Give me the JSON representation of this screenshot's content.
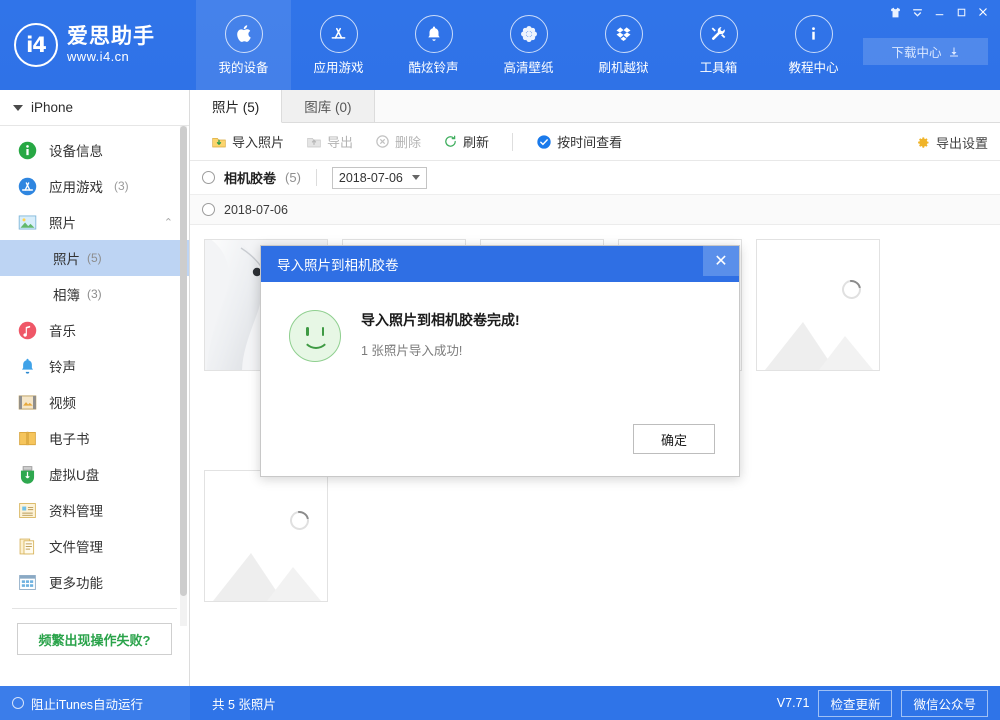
{
  "app": {
    "brand_cn": "爱思助手",
    "brand_url": "www.i4.cn",
    "logo_text": "i4",
    "version": "V7.71"
  },
  "topnav": {
    "items": [
      {
        "label": "我的设备",
        "icon": "apple-icon",
        "active": true
      },
      {
        "label": "应用游戏",
        "icon": "appstore-icon",
        "active": false
      },
      {
        "label": "酷炫铃声",
        "icon": "bell-icon",
        "active": false
      },
      {
        "label": "高清壁纸",
        "icon": "flower-icon",
        "active": false
      },
      {
        "label": "刷机越狱",
        "icon": "box-icon",
        "active": false
      },
      {
        "label": "工具箱",
        "icon": "tools-icon",
        "active": false
      },
      {
        "label": "教程中心",
        "icon": "info-icon",
        "active": false
      }
    ],
    "download_center": "下载中心",
    "window_buttons": [
      "skin-icon",
      "chevron-down-icon",
      "minimize-icon",
      "maximize-icon",
      "close-icon"
    ]
  },
  "sidebar": {
    "device_name": "iPhone",
    "items": [
      {
        "label": "设备信息",
        "count": "",
        "icon": "info-circle-icon"
      },
      {
        "label": "应用游戏",
        "count": "(3)",
        "icon": "appstore-icon"
      },
      {
        "label": "照片",
        "count": "",
        "icon": "photo-icon",
        "expanded": true
      }
    ],
    "photo_subitems": [
      {
        "label": "照片",
        "count": "(5)",
        "selected": true
      },
      {
        "label": "相簿",
        "count": "(3)",
        "selected": false
      }
    ],
    "items_after": [
      {
        "label": "音乐",
        "count": "",
        "icon": "music-icon"
      },
      {
        "label": "铃声",
        "count": "",
        "icon": "ringtone-icon"
      },
      {
        "label": "视频",
        "count": "",
        "icon": "video-icon"
      },
      {
        "label": "电子书",
        "count": "",
        "icon": "book-icon"
      },
      {
        "label": "虚拟U盘",
        "count": "",
        "icon": "usb-icon"
      },
      {
        "label": "资料管理",
        "count": "",
        "icon": "data-icon"
      },
      {
        "label": "文件管理",
        "count": "",
        "icon": "file-icon"
      },
      {
        "label": "更多功能",
        "count": "",
        "icon": "grid-icon"
      }
    ],
    "help_button": "频繁出现操作失败?"
  },
  "main": {
    "tabs": [
      {
        "label": "照片 (5)",
        "active": true
      },
      {
        "label": "图库 (0)",
        "active": false
      }
    ],
    "toolbar": {
      "import": "导入照片",
      "export": "导出",
      "delete": "删除",
      "refresh": "刷新",
      "view_by_time": "按时间查看",
      "export_settings": "导出设置"
    },
    "filter": {
      "album_label": "相机胶卷",
      "album_count": "(5)",
      "date_value": "2018-07-06"
    },
    "date_group": "2018-07-06",
    "thumbnails": [
      {
        "name": "photo-earphones",
        "kind": "photo"
      },
      {
        "name": "photo-placeholder-2",
        "kind": "placeholder"
      },
      {
        "name": "photo-placeholder-3",
        "kind": "placeholder"
      },
      {
        "name": "photo-placeholder-4",
        "kind": "placeholder"
      },
      {
        "name": "photo-placeholder-5",
        "kind": "placeholder"
      },
      {
        "name": "photo-placeholder-6",
        "kind": "placeholder"
      }
    ]
  },
  "modal": {
    "title": "导入照片到相机胶卷",
    "message_main": "导入照片到相机胶卷完成!",
    "message_sub": "1 张照片导入成功!",
    "ok_label": "确定",
    "close_label": "✕"
  },
  "statusbar": {
    "itunes_toggle": "阻止iTunes自动运行",
    "photo_count": "共 5 张照片",
    "check_update": "检查更新",
    "wechat": "微信公众号"
  },
  "colors": {
    "brand_blue": "#2f74e8",
    "modal_blue": "#2f6fe4",
    "selected_blue": "#bdd4f3",
    "green": "#2aa34a"
  }
}
